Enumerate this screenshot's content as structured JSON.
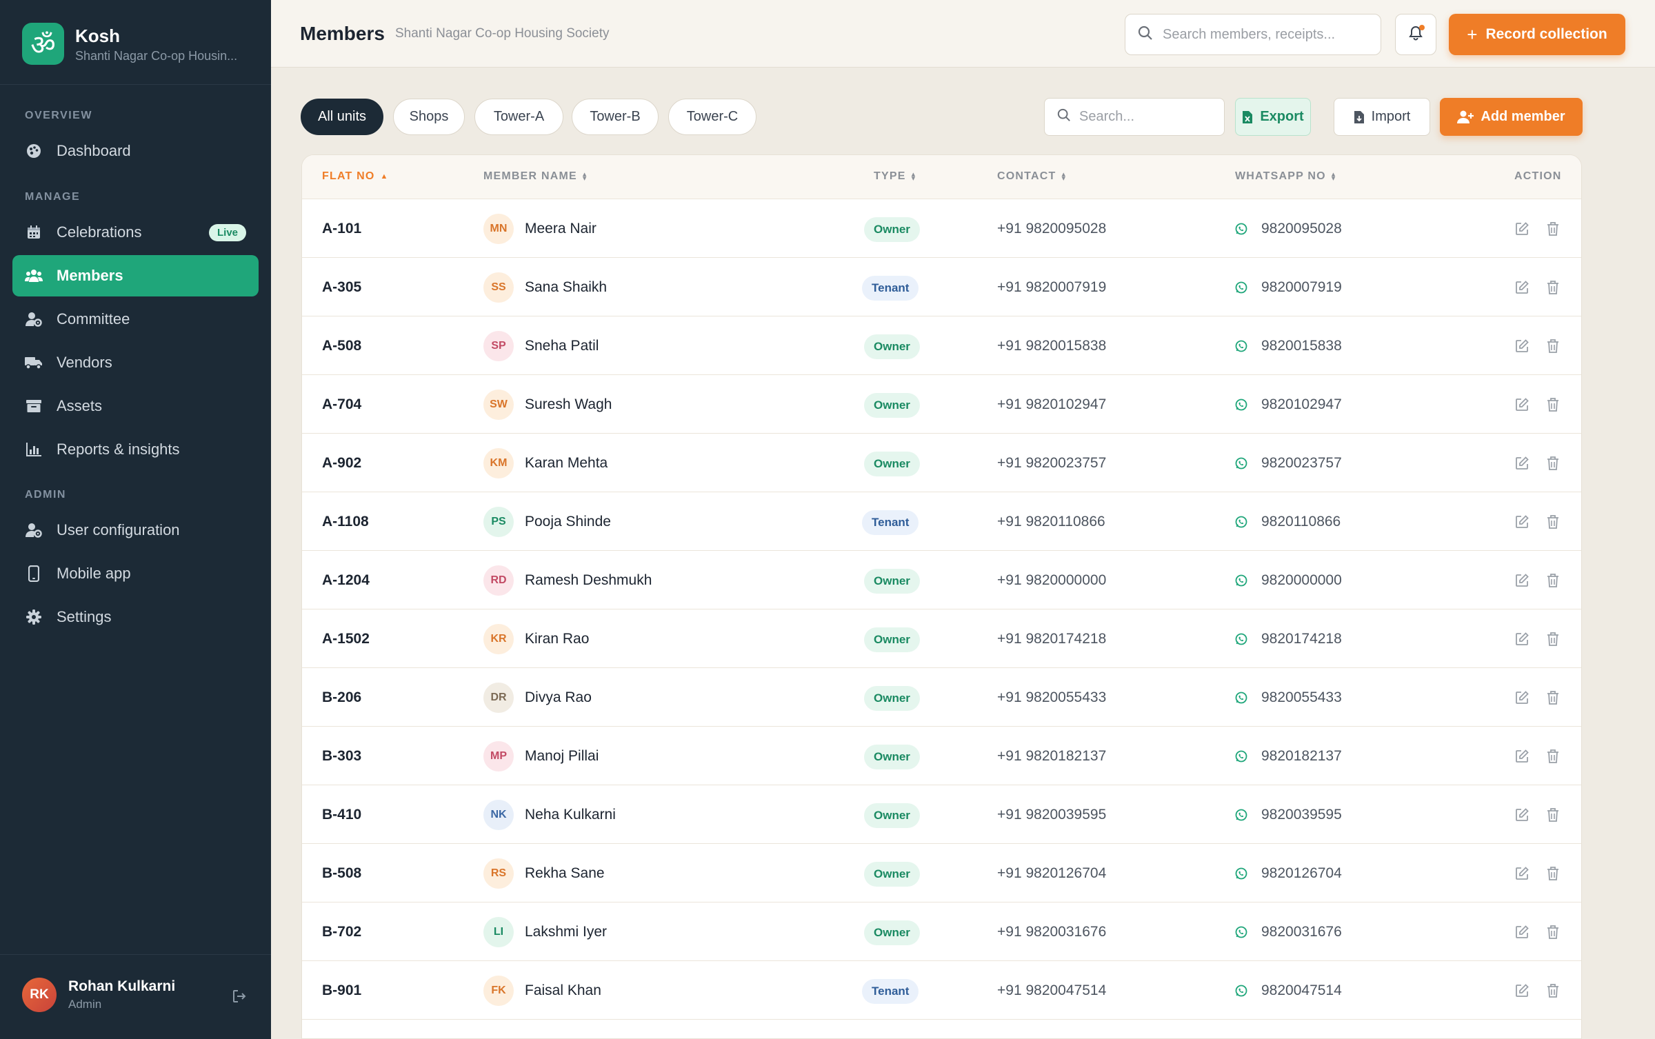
{
  "brand": {
    "name": "Kosh",
    "subtitle": "Shanti Nagar Co-op Housin...",
    "logo_glyph": "ॐ"
  },
  "sidebar": {
    "sections": {
      "overview": "OVERVIEW",
      "manage": "MANAGE",
      "admin": "ADMIN"
    },
    "items": [
      {
        "label": "Dashboard",
        "icon": "palette-icon"
      },
      {
        "label": "Celebrations",
        "icon": "calendar-icon",
        "badge": "Live"
      },
      {
        "label": "Members",
        "icon": "users-icon",
        "active": true
      },
      {
        "label": "Committee",
        "icon": "user-cog-icon"
      },
      {
        "label": "Vendors",
        "icon": "truck-icon"
      },
      {
        "label": "Assets",
        "icon": "archive-icon"
      },
      {
        "label": "Reports & insights",
        "icon": "chart-icon"
      },
      {
        "label": "User configuration",
        "icon": "user-settings-icon"
      },
      {
        "label": "Mobile app",
        "icon": "phone-icon"
      },
      {
        "label": "Settings",
        "icon": "gear-icon"
      }
    ],
    "user": {
      "initials": "RK",
      "name": "Rohan Kulkarni",
      "role": "Admin"
    }
  },
  "header": {
    "title": "Members",
    "subtitle": "Shanti Nagar Co-op Housing Society",
    "search_placeholder": "Search members, receipts...",
    "record_label": "Record collection"
  },
  "toolbar": {
    "filters": [
      "All units",
      "Shops",
      "Tower-A",
      "Tower-B",
      "Tower-C"
    ],
    "active_filter": "All units",
    "search_placeholder": "Search...",
    "export_label": "Export",
    "import_label": "Import",
    "add_label": "Add member"
  },
  "table": {
    "columns": {
      "flat": "FLAT NO",
      "member": "MEMBER NAME",
      "type": "TYPE",
      "contact": "CONTACT",
      "whatsapp": "WHATSAPP NO",
      "action": "ACTION"
    },
    "rows": [
      {
        "flat": "A-101",
        "initials": "MN",
        "name": "Meera Nair",
        "type": "Owner",
        "contact": "+91 9820095028",
        "whatsapp": "9820095028",
        "avatar_bg": "#fdeedd",
        "avatar_fg": "#d9752a"
      },
      {
        "flat": "A-305",
        "initials": "SS",
        "name": "Sana Shaikh",
        "type": "Tenant",
        "contact": "+91 9820007919",
        "whatsapp": "9820007919",
        "avatar_bg": "#fdeedd",
        "avatar_fg": "#d9752a"
      },
      {
        "flat": "A-508",
        "initials": "SP",
        "name": "Sneha Patil",
        "type": "Owner",
        "contact": "+91 9820015838",
        "whatsapp": "9820015838",
        "avatar_bg": "#fbe6ea",
        "avatar_fg": "#c24a64"
      },
      {
        "flat": "A-704",
        "initials": "SW",
        "name": "Suresh Wagh",
        "type": "Owner",
        "contact": "+91 9820102947",
        "whatsapp": "9820102947",
        "avatar_bg": "#fdeedd",
        "avatar_fg": "#d9752a"
      },
      {
        "flat": "A-902",
        "initials": "KM",
        "name": "Karan Mehta",
        "type": "Owner",
        "contact": "+91 9820023757",
        "whatsapp": "9820023757",
        "avatar_bg": "#fdeedd",
        "avatar_fg": "#d9752a"
      },
      {
        "flat": "A-1108",
        "initials": "PS",
        "name": "Pooja Shinde",
        "type": "Tenant",
        "contact": "+91 9820110866",
        "whatsapp": "9820110866",
        "avatar_bg": "#e3f5ec",
        "avatar_fg": "#1a8a62"
      },
      {
        "flat": "A-1204",
        "initials": "RD",
        "name": "Ramesh Deshmukh",
        "type": "Owner",
        "contact": "+91 9820000000",
        "whatsapp": "9820000000",
        "avatar_bg": "#fbe6ea",
        "avatar_fg": "#c24a64"
      },
      {
        "flat": "A-1502",
        "initials": "KR",
        "name": "Kiran Rao",
        "type": "Owner",
        "contact": "+91 9820174218",
        "whatsapp": "9820174218",
        "avatar_bg": "#fdeedd",
        "avatar_fg": "#d9752a"
      },
      {
        "flat": "B-206",
        "initials": "DR",
        "name": "Divya Rao",
        "type": "Owner",
        "contact": "+91 9820055433",
        "whatsapp": "9820055433",
        "avatar_bg": "#f1ece3",
        "avatar_fg": "#7c6a55"
      },
      {
        "flat": "B-303",
        "initials": "MP",
        "name": "Manoj Pillai",
        "type": "Owner",
        "contact": "+91 9820182137",
        "whatsapp": "9820182137",
        "avatar_bg": "#fbe6ea",
        "avatar_fg": "#c24a64"
      },
      {
        "flat": "B-410",
        "initials": "NK",
        "name": "Neha Kulkarni",
        "type": "Owner",
        "contact": "+91 9820039595",
        "whatsapp": "9820039595",
        "avatar_bg": "#e8eff9",
        "avatar_fg": "#3b67a4"
      },
      {
        "flat": "B-508",
        "initials": "RS",
        "name": "Rekha Sane",
        "type": "Owner",
        "contact": "+91 9820126704",
        "whatsapp": "9820126704",
        "avatar_bg": "#fdeedd",
        "avatar_fg": "#d9752a"
      },
      {
        "flat": "B-702",
        "initials": "LI",
        "name": "Lakshmi Iyer",
        "type": "Owner",
        "contact": "+91 9820031676",
        "whatsapp": "9820031676",
        "avatar_bg": "#e3f5ec",
        "avatar_fg": "#1a8a62"
      },
      {
        "flat": "B-901",
        "initials": "FK",
        "name": "Faisal Khan",
        "type": "Tenant",
        "contact": "+91 9820047514",
        "whatsapp": "9820047514",
        "avatar_bg": "#fdeedd",
        "avatar_fg": "#d9752a"
      }
    ]
  },
  "colors": {
    "sidebar": "#1c2a36",
    "accent_green": "#1fa67a",
    "accent_orange": "#ef7d27",
    "background": "#efebe3"
  }
}
